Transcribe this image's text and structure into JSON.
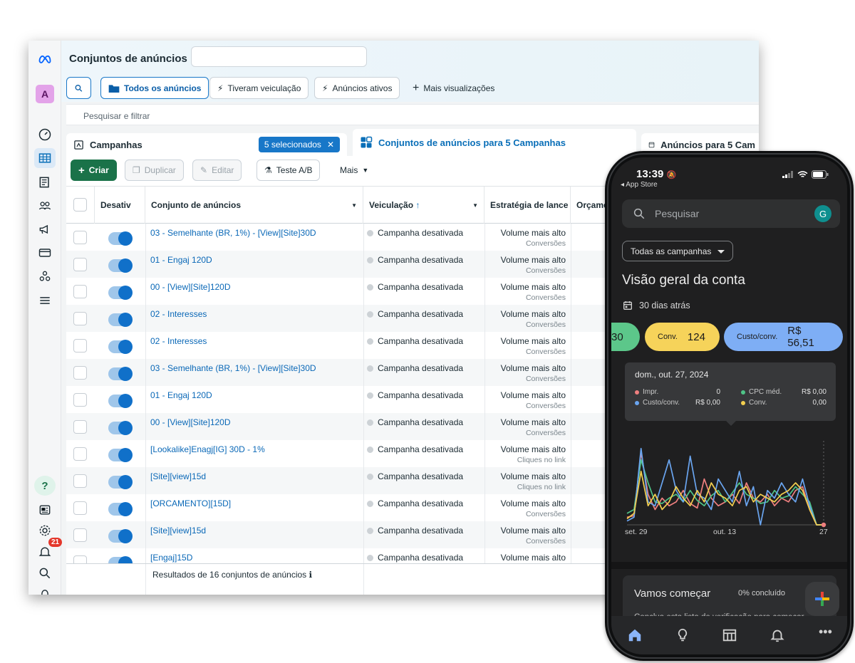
{
  "desktop": {
    "page_title": "Conjuntos de anúncios",
    "views": {
      "all_ads": "Todos os anúncios",
      "delivered": "Tiveram veiculação",
      "active_ads": "Anúncios ativos",
      "more_views": "Mais visualizações"
    },
    "search_placeholder": "Pesquisar e filtrar",
    "panels": {
      "campaigns": "Campanhas",
      "selected_chip": "5 selecionados",
      "adsets_tab": "Conjuntos de anúncios para 5 Campanhas",
      "ads_tab": "Anúncios para 5 Cam"
    },
    "actions": {
      "create": "Criar",
      "duplicate": "Duplicar",
      "edit": "Editar",
      "ab_test": "Teste A/B",
      "more": "Mais"
    },
    "columns": {
      "toggle": "Desativ",
      "name": "Conjunto de anúncios",
      "delivery": "Veiculação",
      "strategy": "Estratégia de lance",
      "budget": "Orçame"
    },
    "rows": [
      {
        "name": "03 - Semelhante (BR, 1%) - [View][Site]30D",
        "delivery": "Campanha desativada",
        "strategy": "Volume mais alto",
        "sub": "Conversões"
      },
      {
        "name": "01 - Engaj 120D",
        "delivery": "Campanha desativada",
        "strategy": "Volume mais alto",
        "sub": "Conversões"
      },
      {
        "name": "00 - [View][Site]120D",
        "delivery": "Campanha desativada",
        "strategy": "Volume mais alto",
        "sub": "Conversões"
      },
      {
        "name": "02 - Interesses",
        "delivery": "Campanha desativada",
        "strategy": "Volume mais alto",
        "sub": "Conversões"
      },
      {
        "name": "02 - Interesses",
        "delivery": "Campanha desativada",
        "strategy": "Volume mais alto",
        "sub": "Conversões"
      },
      {
        "name": "03 - Semelhante (BR, 1%) - [View][Site]30D",
        "delivery": "Campanha desativada",
        "strategy": "Volume mais alto",
        "sub": "Conversões"
      },
      {
        "name": "01 - Engaj 120D",
        "delivery": "Campanha desativada",
        "strategy": "Volume mais alto",
        "sub": "Conversões"
      },
      {
        "name": "00 - [View][Site]120D",
        "delivery": "Campanha desativada",
        "strategy": "Volume mais alto",
        "sub": "Conversões"
      },
      {
        "name": "[Lookalike]Enagj[IG] 30D - 1%",
        "delivery": "Campanha desativada",
        "strategy": "Volume mais alto",
        "sub": "Cliques no link"
      },
      {
        "name": "[Site][view]15d",
        "delivery": "Campanha desativada",
        "strategy": "Volume mais alto",
        "sub": "Cliques no link"
      },
      {
        "name": "[ORCAMENTO][15D]",
        "delivery": "Campanha desativada",
        "strategy": "Volume mais alto",
        "sub": "Conversões"
      },
      {
        "name": "[Site][view]15d",
        "delivery": "Campanha desativada",
        "strategy": "Volume mais alto",
        "sub": "Conversões"
      },
      {
        "name": "[Engaj]15D",
        "delivery": "Campanha desativada",
        "strategy": "Volume mais alto",
        "sub": ""
      }
    ],
    "footer": "Resultados de 16 conjuntos de anúncios",
    "notification_count": "21",
    "avatar_letter": "A"
  },
  "phone": {
    "time": "13:39",
    "back_app": "◂ App Store",
    "search_placeholder": "Pesquisar",
    "avatar_letter": "G",
    "campaign_filter": "Todas as campanhas",
    "overview_title": "Visão geral da conta",
    "period": "30 dias atrás",
    "metrics": [
      {
        "label": "",
        "value": "30",
        "color": "#5cc78a"
      },
      {
        "label": "Conv.",
        "value": "124",
        "color": "#f6d35a"
      },
      {
        "label": "Custo/conv.",
        "value": "R$ 56,51",
        "color": "#7eaef5"
      }
    ],
    "tooltip": {
      "date": "dom., out. 27, 2024",
      "items": [
        {
          "label": "Impr.",
          "value": "0",
          "color": "#ef7f7f"
        },
        {
          "label": "CPC méd.",
          "value": "R$ 0,00",
          "color": "#4fc487"
        },
        {
          "label": "Custo/conv.",
          "value": "R$ 0,00",
          "color": "#6aa5f0"
        },
        {
          "label": "Conv.",
          "value": "0,00",
          "color": "#f3cf4f"
        }
      ]
    },
    "getting_started": {
      "title": "Vamos começar",
      "progress": "0% concluído",
      "subtitle": "Conclua esta lista de verificação para começar"
    }
  },
  "chart_data": {
    "type": "line",
    "x_tick_labels": [
      "set. 29",
      "out. 13",
      "27"
    ],
    "x": [
      "set. 29",
      "set. 30",
      "out. 1",
      "out. 2",
      "out. 3",
      "out. 4",
      "out. 5",
      "out. 6",
      "out. 7",
      "out. 8",
      "out. 9",
      "out. 10",
      "out. 11",
      "out. 12",
      "out. 13",
      "out. 14",
      "out. 15",
      "out. 16",
      "out. 17",
      "out. 18",
      "out. 19",
      "out. 20",
      "out. 21",
      "out. 22",
      "out. 23",
      "out. 24",
      "out. 25",
      "out. 26",
      "out. 27"
    ],
    "series": [
      {
        "name": "Impr.",
        "color": "#ef7f7f",
        "values": [
          10,
          12,
          95,
          40,
          20,
          35,
          25,
          30,
          45,
          28,
          22,
          60,
          35,
          25,
          30,
          40,
          28,
          55,
          35,
          30,
          40,
          25,
          35,
          30,
          45,
          50,
          20,
          0,
          0
        ]
      },
      {
        "name": "CPC méd.",
        "color": "#4fc487",
        "values": [
          15,
          20,
          85,
          55,
          30,
          28,
          35,
          40,
          30,
          45,
          32,
          25,
          38,
          45,
          30,
          42,
          55,
          40,
          35,
          28,
          30,
          45,
          35,
          38,
          50,
          40,
          30,
          0,
          0
        ]
      },
      {
        "name": "Custo/conv.",
        "color": "#6aa5f0",
        "values": [
          5,
          10,
          100,
          30,
          25,
          55,
          85,
          45,
          30,
          90,
          40,
          35,
          20,
          60,
          45,
          30,
          70,
          25,
          50,
          0,
          45,
          35,
          55,
          40,
          30,
          60,
          25,
          0,
          0
        ]
      },
      {
        "name": "Conv.",
        "color": "#f3cf4f",
        "values": [
          8,
          15,
          70,
          25,
          40,
          20,
          30,
          50,
          35,
          25,
          45,
          30,
          55,
          40,
          35,
          25,
          45,
          50,
          30,
          40,
          35,
          30,
          40,
          45,
          55,
          45,
          20,
          0,
          0
        ]
      }
    ],
    "ylim": [
      0,
      110
    ]
  }
}
